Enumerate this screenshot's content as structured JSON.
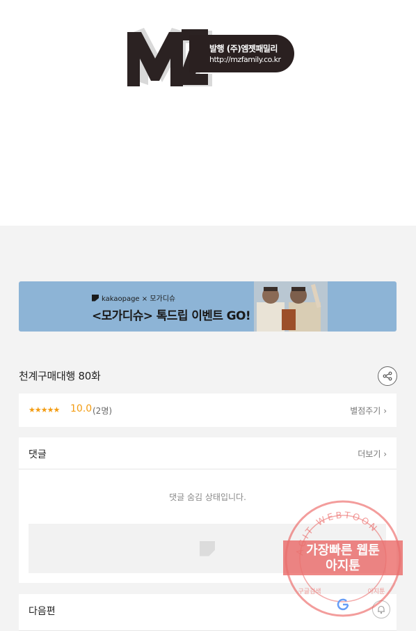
{
  "header": {
    "logo_text": "MZ",
    "publisher": "발행 (주)엠젯패밀리",
    "url": "http://mzfamily.co.kr"
  },
  "banner": {
    "brand": "kakaopage × 모가디슈",
    "title": "<모가디슈> 톡드립 이벤트 GO!"
  },
  "episode": {
    "title": "천계구매대행 80화"
  },
  "rating": {
    "stars": "★★★★★",
    "score": "10.0",
    "count": "(2명)",
    "rate_link": "별점주기"
  },
  "comments": {
    "title": "댓글",
    "more_link": "더보기",
    "hidden_message": "댓글 숨김 상태입니다."
  },
  "next": {
    "title": "다음편"
  },
  "watermark": {
    "arc_text": "AGIT WEBTOON",
    "line1": "가장빠른 웹툰",
    "line2": "아지툰",
    "bottom_left": "구글검색",
    "bottom_right": "아지툰"
  },
  "colors": {
    "accent_star": "#f39c12",
    "banner_bg": "#8db4d6",
    "watermark_red": "#e8504e"
  }
}
